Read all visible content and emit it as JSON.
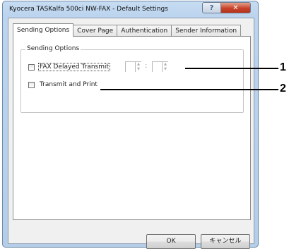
{
  "window": {
    "title": "Kyocera TASKalfa 500ci NW-FAX - Default Settings",
    "help_glyph": "?",
    "close_glyph": "✕"
  },
  "tabs": [
    {
      "label": "Sending Options",
      "active": true
    },
    {
      "label": "Cover Page",
      "active": false
    },
    {
      "label": "Authentication",
      "active": false
    },
    {
      "label": "Sender Information",
      "active": false
    }
  ],
  "sending_options": {
    "group_title": "Sending Options",
    "fax_delayed_transmit": {
      "label": "FAX Delayed Transmit",
      "checked": false
    },
    "time_separator": ":",
    "transmit_and_print": {
      "label": "Transmit and Print",
      "checked": false
    }
  },
  "buttons": {
    "ok": "OK",
    "cancel": "キャンセル"
  },
  "callouts": [
    "1",
    "2"
  ]
}
